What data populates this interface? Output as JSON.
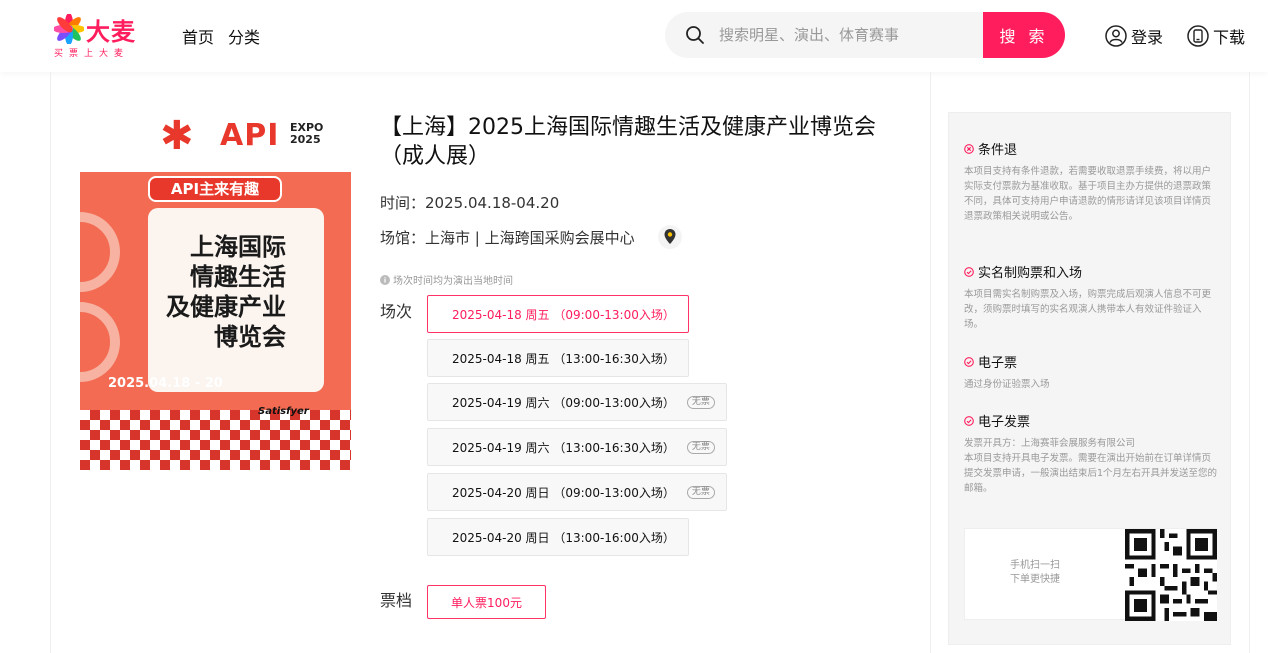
{
  "header": {
    "logo_text": "大麦",
    "logo_sub": "买票上大麦",
    "nav": [
      "首页",
      "分类"
    ],
    "search_placeholder": "搜索明星、演出、体育赛事",
    "search_button": "搜 索",
    "login": "登录",
    "download": "下载",
    "accent_color": "#ff1d5d"
  },
  "poster": {
    "api": "API",
    "expo": "EXPO",
    "year": "2025",
    "tag": "API主来有趣",
    "title_lines": [
      "上海国际",
      "情趣生活",
      "及健康产业",
      "博览会"
    ],
    "date": "2025.04.18 - 20",
    "brand": "Satisfyer"
  },
  "event": {
    "title": "【上海】2025上海国际情趣生活及健康产业博览会（成人展）",
    "time_label": "时间：",
    "time": "2025.04.18-04.20",
    "venue_label": "场馆：",
    "venue": "上海市 | 上海跨国采购会展中心",
    "note": "场次时间均为演出当地时间",
    "session_label": "场次",
    "sessions": [
      {
        "text": "2025-04-18 周五 （09:00-13:00入场）",
        "badge": "",
        "selected": true
      },
      {
        "text": "2025-04-18 周五 （13:00-16:30入场）",
        "badge": "",
        "selected": false
      },
      {
        "text": "2025-04-19 周六 （09:00-13:00入场）",
        "badge": "无票",
        "selected": false
      },
      {
        "text": "2025-04-19 周六 （13:00-16:30入场）",
        "badge": "无票",
        "selected": false
      },
      {
        "text": "2025-04-20 周日 （09:00-13:00入场）",
        "badge": "无票",
        "selected": false
      },
      {
        "text": "2025-04-20 周日 （13:00-16:00入场）",
        "badge": "",
        "selected": false
      }
    ],
    "tier_label": "票档",
    "tier": "单人票100元"
  },
  "policy": {
    "items": [
      {
        "icon": "cross-circle-icon",
        "title": "条件退",
        "desc": "本项目支持有条件退款，若需要收取退票手续费，将以用户实际支付票款为基准收取。基于项目主办方提供的退票政策不同，具体可支持用户申请退款的情形请详见该项目详情页退票政策相关说明或公告。"
      },
      {
        "icon": "check-circle-icon",
        "title": "实名制购票和入场",
        "desc": "本项目需实名制购票及入场，购票完成后观演人信息不可更改，须购票时填写的实名观演人携带本人有效证件验证入场。"
      },
      {
        "icon": "check-circle-icon",
        "title": "电子票",
        "desc": "通过身份证验票入场"
      },
      {
        "icon": "check-circle-icon",
        "title": "电子发票",
        "desc": "发票开具方：上海赛菲会展服务有限公司\n本项目支持开具电子发票。需要在演出开始前在订单详情页提交发票申请，一般演出结束后1个月左右开具并发送至您的邮箱。"
      }
    ],
    "qr_text": "手机扫一扫\n下单更快捷"
  }
}
